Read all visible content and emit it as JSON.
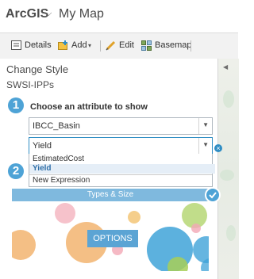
{
  "header": {
    "brand": "ArcGIS",
    "brand_caret": "⌵",
    "map_title": "My Map"
  },
  "toolbar": {
    "details_label": "Details",
    "add_label": "Add",
    "edit_label": "Edit",
    "basemap_label": "Basemap"
  },
  "panel": {
    "title": "Change Style",
    "layer_name": "SWSI-IPPs",
    "step1": {
      "number": "1",
      "heading": "Choose an attribute to show"
    },
    "attribute_1": {
      "value": "IBCC_Basin"
    },
    "attribute_2": {
      "value": "Yield"
    },
    "dropdown": {
      "options": [
        "EstimatedCost",
        "Yield",
        "New Expression"
      ],
      "selected": "Yield"
    },
    "step2": {
      "number": "2"
    },
    "style_card": {
      "title": "Types & Size",
      "options_label": "OPTIONS"
    }
  },
  "colors": {
    "accent": "#4ea3d6",
    "banner": "#7fb9de",
    "selected_bg": "#e5eef7",
    "bubble_orange": "#f0a95c",
    "bubble_blue": "#3fa3d8",
    "bubble_green": "#a7cf58",
    "bubble_pink": "#f2a8b5"
  }
}
